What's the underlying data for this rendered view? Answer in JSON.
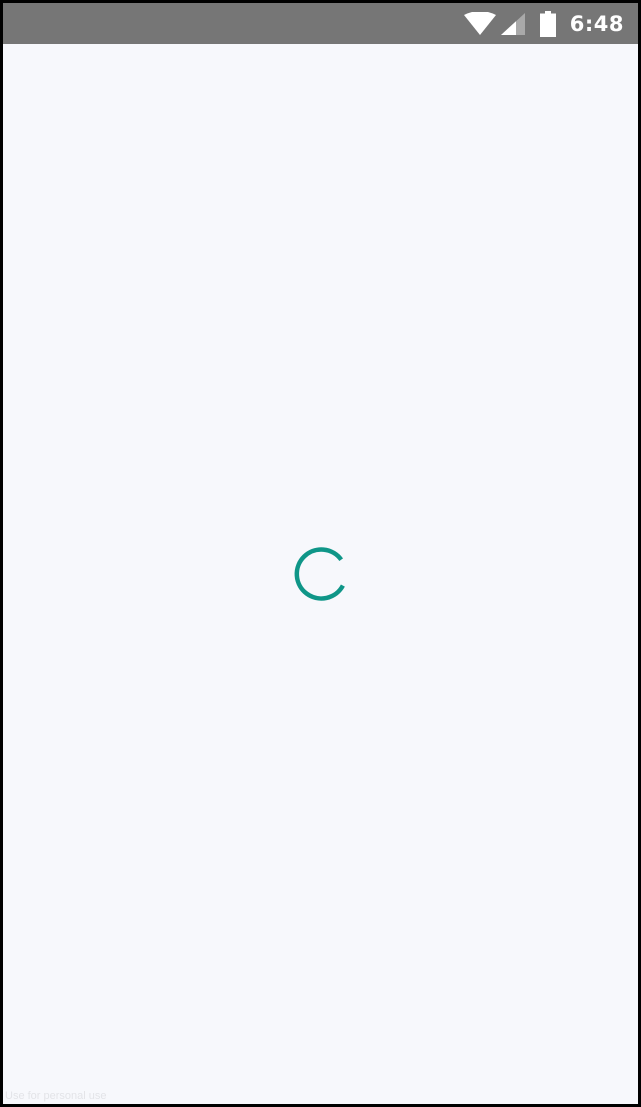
{
  "status_bar": {
    "time": "6:48",
    "background_color": "#767676",
    "icons": [
      "wifi-icon",
      "cellular-signal-icon",
      "battery-icon"
    ]
  },
  "main": {
    "background_color": "#f7f8fc",
    "loading_indicator": {
      "icon": "loading-spinner-icon",
      "color": "#0f9688"
    }
  },
  "watermark": {
    "text": "Use for personal use"
  }
}
